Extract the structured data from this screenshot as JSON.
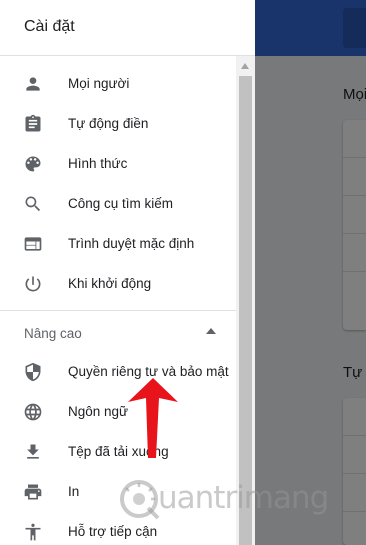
{
  "drawer": {
    "title": "Cài đặt",
    "items": [
      {
        "label": "Mọi người",
        "icon": "person-icon"
      },
      {
        "label": "Tự động điền",
        "icon": "clipboard-icon"
      },
      {
        "label": "Hình thức",
        "icon": "palette-icon"
      },
      {
        "label": "Công cụ tìm kiếm",
        "icon": "search-icon"
      },
      {
        "label": "Trình duyệt mặc định",
        "icon": "browser-window-icon"
      },
      {
        "label": "Khi khởi động",
        "icon": "power-icon"
      }
    ],
    "advanced": {
      "label": "Nâng cao",
      "items": [
        {
          "label": "Quyền riêng tư và bảo mật",
          "icon": "shield-icon"
        },
        {
          "label": "Ngôn ngữ",
          "icon": "globe-icon"
        },
        {
          "label": "Tệp đã tải xuống",
          "icon": "download-icon"
        },
        {
          "label": "In",
          "icon": "printer-icon"
        },
        {
          "label": "Hỗ trợ tiếp cận",
          "icon": "accessibility-icon"
        }
      ]
    }
  },
  "background": {
    "heading_1": "Mọi người",
    "heading_2": "Tự động điền"
  },
  "watermark": {
    "text": "uantrimang",
    "logo_letter": "Q"
  },
  "colors": {
    "header_blue": "#3367d6",
    "icon_gray": "#5f6368",
    "annotation_red": "#e8141c"
  }
}
